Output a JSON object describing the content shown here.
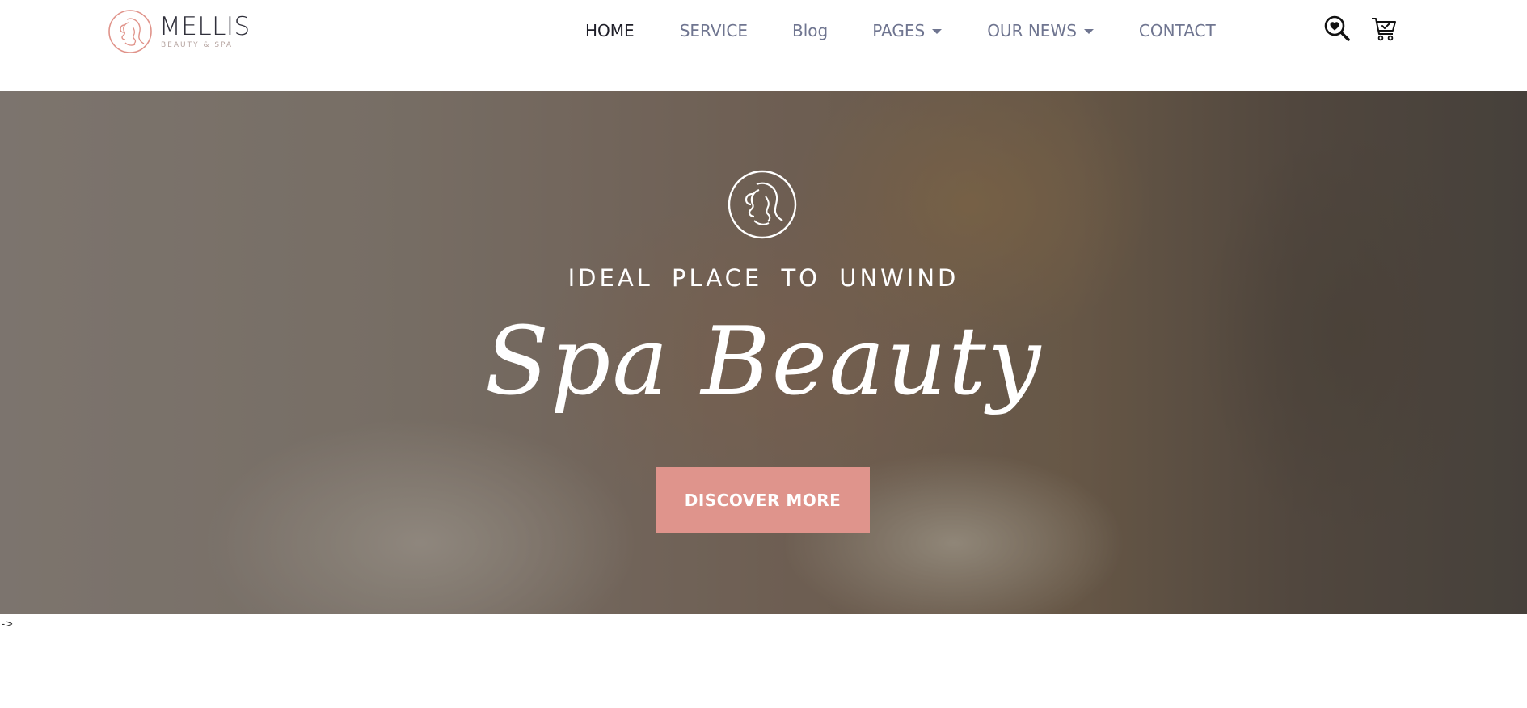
{
  "logo": {
    "name": "MELLIS",
    "tagline": "BEAUTY & SPA",
    "icon": "woman-profile-logo-icon"
  },
  "nav": {
    "items": [
      {
        "label": "HOME",
        "active": true,
        "dropdown": false
      },
      {
        "label": "SERVICE",
        "active": false,
        "dropdown": false
      },
      {
        "label": "Blog",
        "active": false,
        "dropdown": false
      },
      {
        "label": "PAGES",
        "active": false,
        "dropdown": true
      },
      {
        "label": "OUR NEWS",
        "active": false,
        "dropdown": true
      },
      {
        "label": "CONTACT",
        "active": false,
        "dropdown": false
      }
    ]
  },
  "header_icons": {
    "search": "heart-search-icon",
    "cart": "cart-check-icon"
  },
  "hero": {
    "eyebrow": "IDEAL PLACE TO UNWIND",
    "title": "Spa Beauty",
    "button_label": "DISCOVER MORE",
    "emblem_icon": "woman-profile-emblem-icon"
  },
  "stray_text": "->",
  "colors": {
    "accent": "#df948c",
    "nav_text": "#6f7590",
    "nav_active": "#1e1e28",
    "logo_accent": "#e0938a"
  }
}
